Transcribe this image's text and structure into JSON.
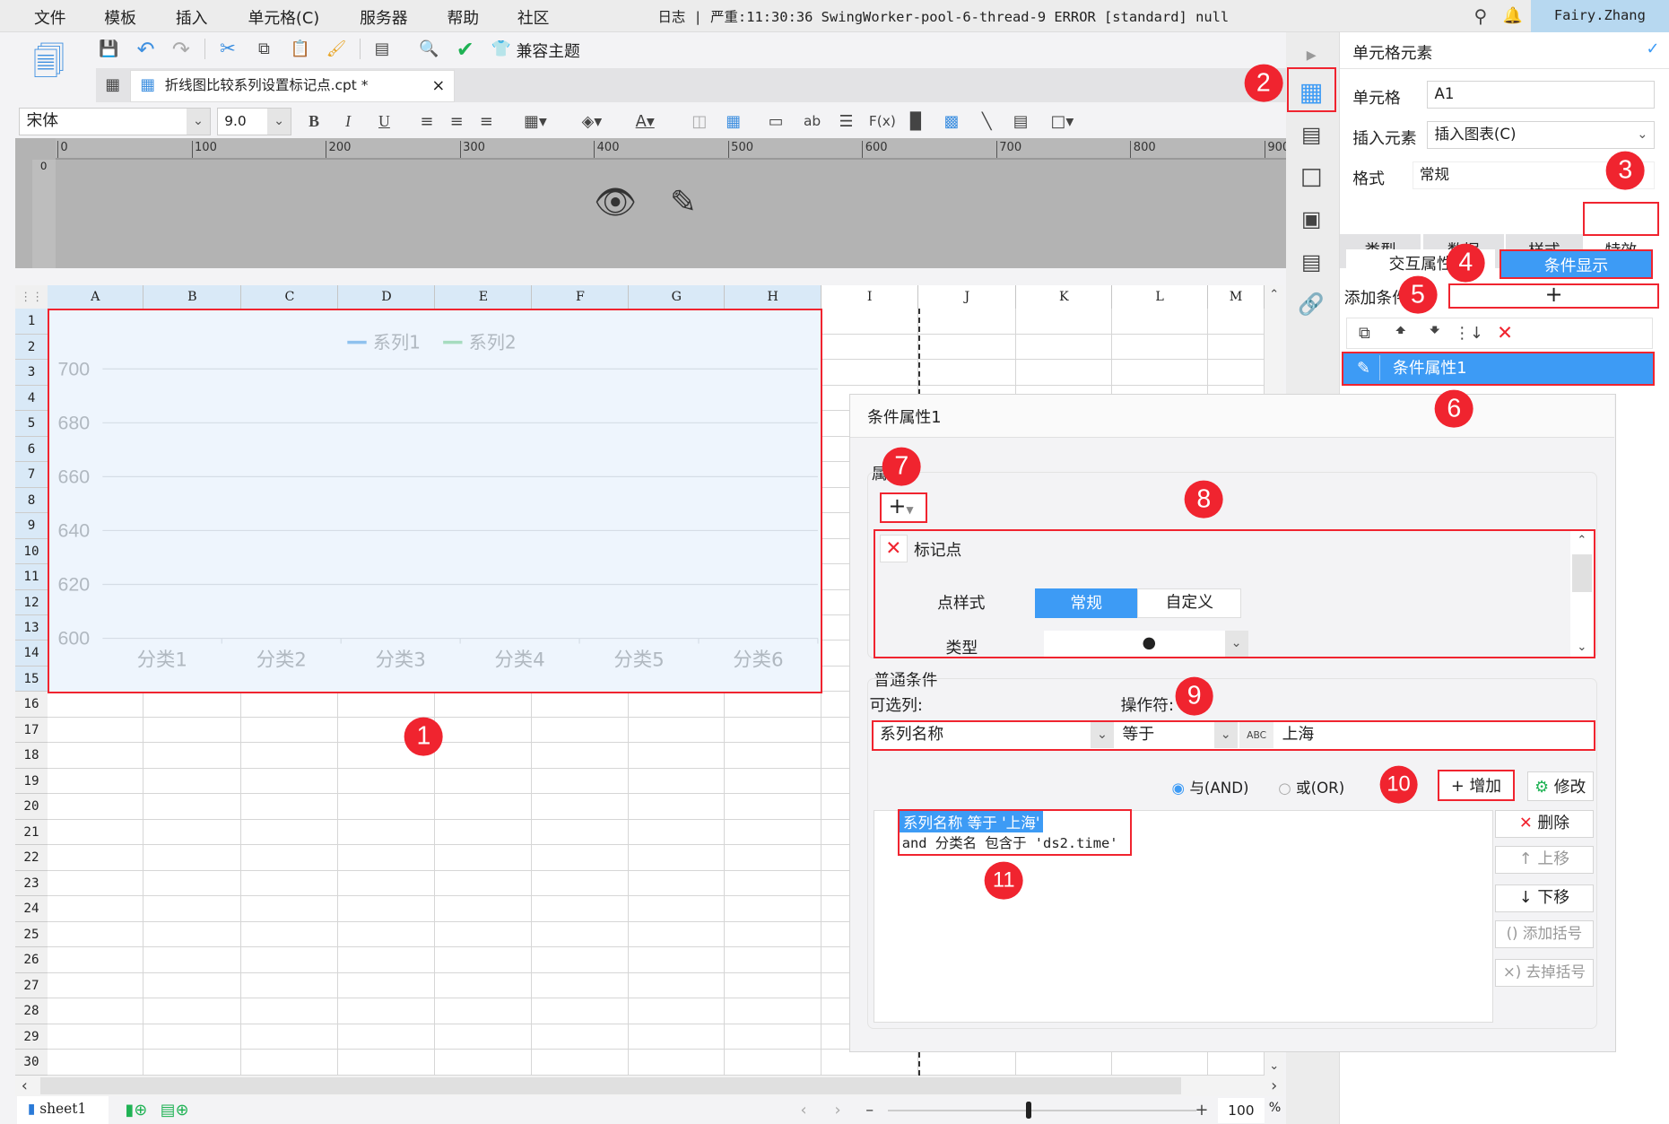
{
  "menubar": {
    "items": [
      "文件",
      "模板",
      "插入",
      "单元格(C)",
      "服务器",
      "帮助",
      "社区"
    ],
    "log": "日志 | 严重:11:30:36 SwingWorker-pool-6-thread-9 ERROR [standard] null",
    "user": "Fairy.Zhang"
  },
  "toolbar": {
    "theme_label": "兼容主题"
  },
  "file_tab": {
    "name": "折线图比较系列设置标记点.cpt *",
    "close": "×"
  },
  "format_bar": {
    "font": "宋体",
    "size": "9.0"
  },
  "ruler": {
    "ticks": [
      "0",
      "100",
      "200",
      "300",
      "400",
      "500",
      "600",
      "700",
      "800",
      "900"
    ]
  },
  "sheet": {
    "columns": [
      "A",
      "B",
      "C",
      "D",
      "E",
      "F",
      "G",
      "H",
      "I",
      "J",
      "K",
      "L",
      "M"
    ],
    "rows": [
      1,
      2,
      3,
      4,
      5,
      6,
      7,
      8,
      9,
      10,
      11,
      12,
      13,
      14,
      15,
      16,
      17,
      18,
      19,
      20,
      21,
      22,
      23,
      24,
      25,
      26,
      27,
      28,
      29,
      30
    ],
    "tab_name": "sheet1",
    "zoom": "100",
    "zoom_unit": "%"
  },
  "chart_data": {
    "type": "line",
    "categories": [
      "分类1",
      "分类2",
      "分类3",
      "分类4",
      "分类5",
      "分类6"
    ],
    "series": [
      {
        "name": "系列1",
        "values": [],
        "color": "#8ec1ee"
      },
      {
        "name": "系列2",
        "values": [],
        "color": "#a6dcbf"
      }
    ],
    "ylim": [
      600,
      700
    ],
    "yticks": [
      600,
      620,
      640,
      660,
      680,
      700
    ],
    "grid": true,
    "legend": "top-center"
  },
  "panel": {
    "title": "单元格元素",
    "cell_label": "单元格",
    "cell_value": "A1",
    "insert_label": "插入元素",
    "insert_value": "插入图表(C)",
    "format_label": "格式",
    "format_value": "常规",
    "tabs": [
      "类型",
      "数据",
      "样式",
      "特效"
    ],
    "subtabs": [
      "交互属性",
      "条件显示"
    ],
    "add_condition_label": "添加条件",
    "add_condition_btn": "+",
    "condition_item": "条件属性1"
  },
  "dialog": {
    "title": "条件属性1",
    "attr_group": "属",
    "add_btn": "+",
    "marker_title": "标记点",
    "point_style_label": "点样式",
    "point_style_options": [
      "常规",
      "自定义"
    ],
    "type_label": "类型",
    "type_value": "●",
    "normal_cond": "普通条件",
    "column_label": "可选列:",
    "operator_label": "操作符:",
    "column_value": "系列名称",
    "operator_value": "等于",
    "value": "上海",
    "and_label": "与(AND)",
    "or_label": "或(OR)",
    "add_label": "增加",
    "modify_label": "修改",
    "delete_label": "删除",
    "up_label": "上移",
    "down_label": "下移",
    "add_bracket_label": "添加括号",
    "remove_bracket_label": "去掉括号",
    "conditions": [
      "系列名称 等于 '上海'",
      "and 分类名 包含于 'ds2.time'"
    ]
  },
  "badges": [
    "1",
    "2",
    "3",
    "4",
    "5",
    "6",
    "7",
    "8",
    "9",
    "10",
    "11"
  ],
  "colors": {
    "accent": "#3d9bf5",
    "annotation": "#f0242f",
    "chart_bg": "#eef5fd"
  }
}
